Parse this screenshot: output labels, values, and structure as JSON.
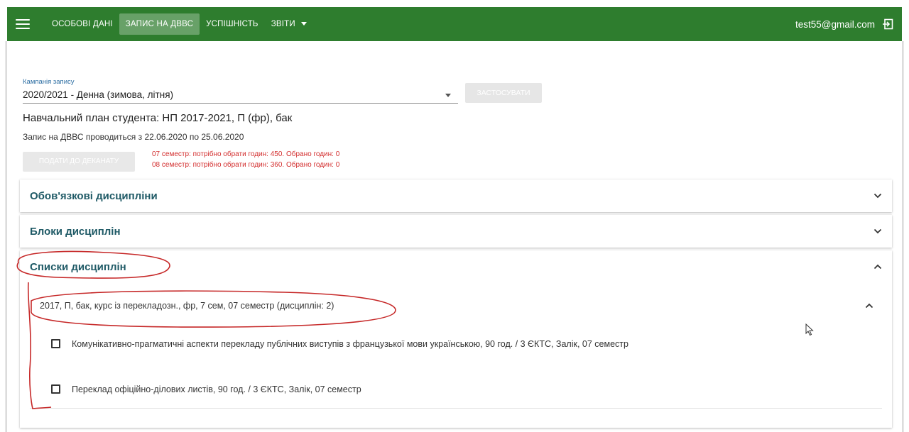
{
  "header": {
    "nav": [
      "ОСОБОВІ ДАНІ",
      "ЗАПИС НА ДВВС",
      "УСПІШНІСТЬ",
      "ЗВІТИ"
    ],
    "user_email": "test55@gmail.com"
  },
  "campaign": {
    "label": "Кампанія запису",
    "value": "2020/2021 - Денна (зимова, літня)",
    "apply_button": "ЗАСТОСУВАТИ"
  },
  "plan_text": "Навчальний план студента: НП 2017-2021, П (фр), бак",
  "period_text": "Запис на ДВВС проводиться з 22.06.2020 по 25.06.2020",
  "submit_button": "ПОДАТИ ДО ДЕКАНАТУ",
  "warnings": [
    "07 семестр: потрібно обрати годин: 450. Обрано годин: 0",
    "08 семестр: потрібно обрати годин: 360. Обрано годин: 0"
  ],
  "panels": {
    "mandatory": "Обов'язкові дисципліни",
    "blocks": "Блоки дисциплін",
    "lists": "Списки дисциплін"
  },
  "list_group": {
    "title": "2017, П, бак, курс із перекладозн., фр, 7 сем, 07 семестр (дисциплін: 2)",
    "items": [
      {
        "label": "Комунікативно-прагматичні аспекти перекладу публічних виступів з французької мови українською, 90 год. / 3 ЄКТС, Залік, 07 семестр",
        "checked": false
      },
      {
        "label": "Переклад офіційно-ділових листів, 90 год. / 3 ЄКТС, Залік, 07 семестр",
        "checked": false
      }
    ]
  },
  "colors": {
    "header_bg": "#2e7d2e",
    "panel_title": "#1f5a66",
    "warning": "#d32f2f",
    "annotation": "#c62828"
  },
  "icons": [
    "menu-icon",
    "caret-down-icon",
    "logout-icon",
    "dropdown-arrow-icon",
    "chevron-down-icon",
    "chevron-up-icon",
    "checkbox-icon",
    "mouse-cursor-icon"
  ]
}
